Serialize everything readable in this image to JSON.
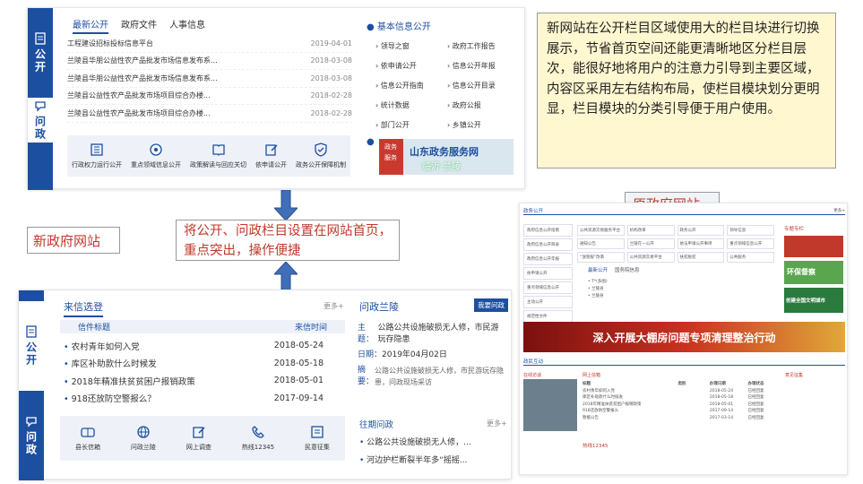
{
  "top": {
    "sidebar": {
      "s1": "公开",
      "s2": "问政"
    },
    "tabs": [
      "最新公开",
      "政府文件",
      "人事信息"
    ],
    "rows": [
      {
        "t": "工程建设招标投标信息平台",
        "d": "2019-04-01"
      },
      {
        "t": "兰陵县华朋公益性农产品批发市场信息发布系...",
        "d": "2018-03-08"
      },
      {
        "t": "兰陵县华朋公益性农产品批发市场信息发布系...",
        "d": "2018-03-08"
      },
      {
        "t": "兰陵县公益性农产品批发市场项目综合办楼...",
        "d": "2018-02-28"
      },
      {
        "t": "兰陵县公益性农产品批发市场项目综合办楼...",
        "d": "2018-02-28"
      }
    ],
    "icons": [
      "行政权力运行公开",
      "重点领域信息公开",
      "政策解读与回应关切",
      "依申请公开",
      "政务公开保障机制"
    ],
    "basic_title": "基本信息公开",
    "basic": [
      "领导之窗",
      "政府工作报告",
      "依申请公开",
      "信息公开年报",
      "信息公开指南",
      "信息公开目录",
      "统计数据",
      "政府公报",
      "部门公开",
      "乡镇公开"
    ],
    "banner_a": "山东政务服务网",
    "banner_b": "临沂·兰陵",
    "logo_lines": [
      "政务",
      "服务"
    ]
  },
  "note_top": "新网站在公开栏目区域使用大的栏目块进行切换展示，节省首页空间还能更清晰地区分栏目层次，能很好地将用户的注意力引导到主要区域，内容区采用左右结构布局，使栏目模块划分更明显，栏目模块的分类引导便于用户使用。",
  "note_mid": "将公开、问政栏目设置在网站首页，重点突出，操作便捷",
  "label_new": "新政府网站",
  "label_old": "原政府网站",
  "bottom": {
    "sidebar": {
      "s1": "公开",
      "s2": "问政"
    },
    "title": "来信选登",
    "more": "更多+",
    "h_title": "信件标题",
    "h_time": "来信时间",
    "rows": [
      {
        "t": "农村青年如何入党",
        "d": "2018-05-24"
      },
      {
        "t": "库区补助款什么时候发",
        "d": "2018-05-18"
      },
      {
        "t": "2018年精准扶贫贫困户报销政策",
        "d": "2018-05-01"
      },
      {
        "t": "918还放防空警报么？",
        "d": "2017-09-14"
      }
    ],
    "icons": [
      "县长信箱",
      "问政兰陵",
      "网上调查",
      "热线12345",
      "民意征集"
    ],
    "r_title": "问政兰陵",
    "r_btn": "我要问政",
    "topic_label": "主题：",
    "topic": "公路公共设施破损无人修，市民游玩存隐患",
    "date_label": "日期：",
    "date": "2019年04月02日",
    "abs_label": "摘要：",
    "abs": "公路公共设施破损无人修，市民游玩存隐患，问政现场采访",
    "r2_title": "往期问政",
    "r2_more": "更多+",
    "r2_items": [
      "公路公共设施破损无人修，...",
      "河边护栏断裂半年多“摇摇..."
    ]
  },
  "old": {
    "h1": "政务公开",
    "more": "更多+",
    "menu": [
      "政府信息公开指南",
      "政府信息公开目录",
      "政府信息公开年报",
      "依申请公开",
      "重点领域信息公开",
      "主动公开",
      "规范性文件",
      "乡镇公开"
    ],
    "grid": [
      "公共资源交易服务平台",
      "机构改革",
      "政务公开",
      "领导信息",
      "通知公告",
      "兰陵在一公开",
      "依法申请公开事项",
      "重点领域信息公开",
      "“放管服”改革",
      "公共资源交易平台",
      "扶贫脱贫",
      "公共服务"
    ],
    "tabs": [
      "最新公开",
      "国务院信息"
    ],
    "items": [
      "T*(多图)",
      "兰陵县",
      "兰陵县"
    ],
    "special": "专题专栏",
    "banner": "深入开展大棚房问题专项清理整治行动",
    "promo1": "环保督察",
    "promo2": "创建全国文明城市",
    "h2": "政民互动",
    "tabs2": [
      "在线访谈",
      "网上信箱",
      "意见征集"
    ],
    "box2": "热线12345",
    "table_h": [
      "标题",
      "类别",
      "办理日期",
      "办理状态"
    ],
    "table": [
      {
        "t": "农村青年如何入党",
        "c": "",
        "d": "2018-05-24",
        "s": "已经回复"
      },
      {
        "t": "库区补助款什么时候发",
        "c": "",
        "d": "2018-05-18",
        "s": "已经回复"
      },
      {
        "t": "2018年精准扶贫贫困户报销政策",
        "c": "",
        "d": "2018-05-01",
        "s": "已经回复"
      },
      {
        "t": "918还放防空警报么",
        "c": "",
        "d": "2017-09-14",
        "s": "已经回复"
      },
      {
        "t": "暂缓公告",
        "c": "",
        "d": "2017-03-14",
        "s": "已经回复"
      }
    ]
  }
}
